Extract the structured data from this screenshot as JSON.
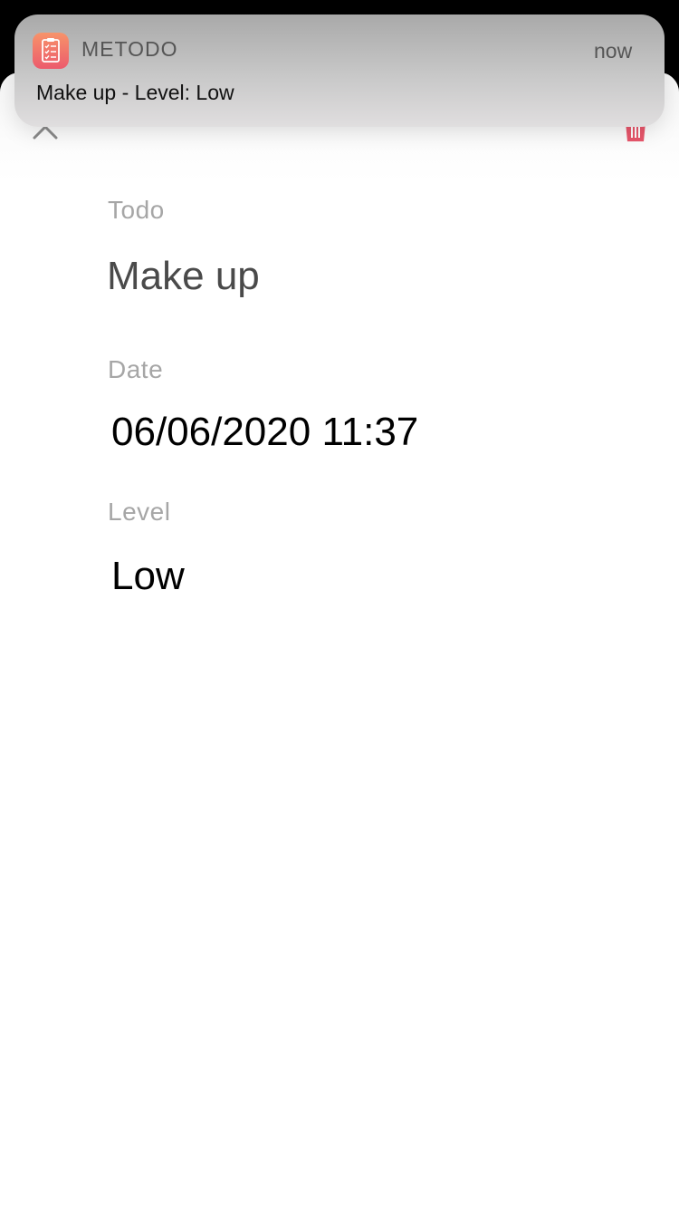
{
  "notification": {
    "app_name": "METODO",
    "time": "now",
    "message": "Make up - Level: Low",
    "icon": "clipboard-checklist-icon",
    "icon_gradient": [
      "#f7936a",
      "#ec5b6c"
    ]
  },
  "toolbar": {
    "close_icon": "close-icon",
    "delete_icon": "trash-icon",
    "delete_color": "#e8566b"
  },
  "detail": {
    "todo_label": "Todo",
    "todo_value": "Make up",
    "date_label": "Date",
    "date_value": "06/06/2020 11:37",
    "level_label": "Level",
    "level_value": "Low"
  }
}
